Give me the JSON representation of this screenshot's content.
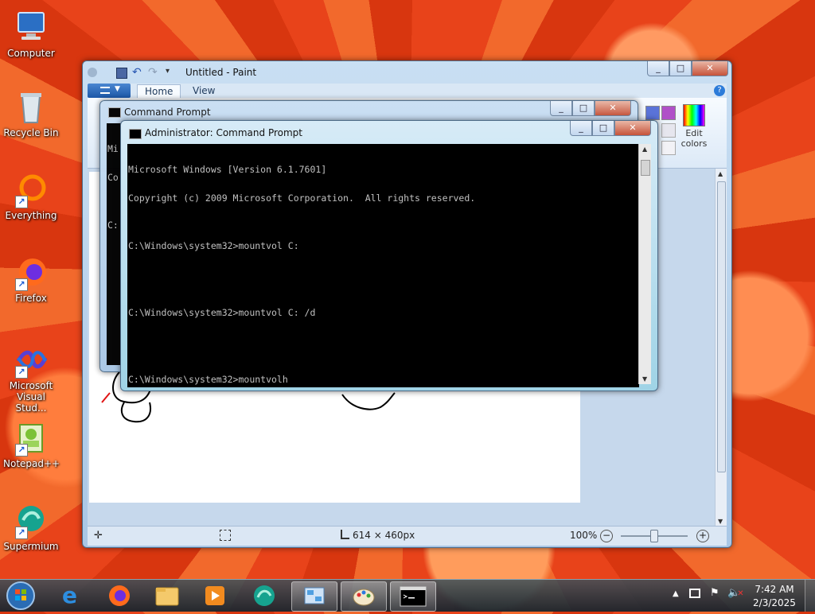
{
  "desktop": {
    "icons": [
      {
        "label": "Computer"
      },
      {
        "label": "Recycle Bin"
      },
      {
        "label": "Everything"
      },
      {
        "label": "Firefox"
      },
      {
        "label": "Microsoft Visual Stud..."
      },
      {
        "label": "Notepad++"
      },
      {
        "label": "Supermium"
      }
    ]
  },
  "paint": {
    "title": "Untitled - Paint",
    "tabs": [
      "Home",
      "View"
    ],
    "edit_colors_label": "Edit colors",
    "status": {
      "dimensions": "614 × 460px",
      "zoom": "100%"
    },
    "zoom_value": 0.5
  },
  "cmd_back": {
    "title": "Command Prompt",
    "visible_text": [
      "Mi",
      "Co",
      "",
      "C:"
    ]
  },
  "cmd_front": {
    "title": "Administrator: Command Prompt",
    "lines": [
      "Microsoft Windows [Version 6.1.7601]",
      "Copyright (c) 2009 Microsoft Corporation.  All rights reserved.",
      "",
      "C:\\Windows\\system32>mountvol C:",
      "",
      "",
      "C:\\Windows\\system32>mountvol C: /d",
      "",
      "",
      "C:\\Windows\\system32>mountvolh"
    ]
  },
  "taskbar": {
    "time": "7:42 AM",
    "date": "2/3/2025"
  },
  "icons": {
    "min": "_",
    "max": "□",
    "close": "✕",
    "shortcut": "↗"
  }
}
